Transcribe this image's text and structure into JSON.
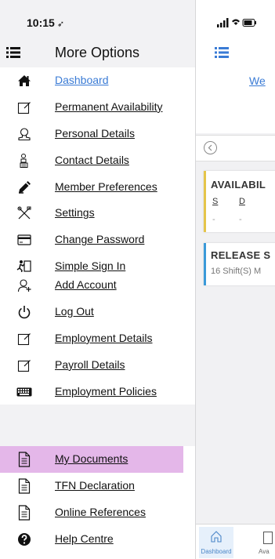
{
  "status": {
    "time": "10:15",
    "location_glyph": "➶"
  },
  "drawer": {
    "title": "More Options",
    "section1": [
      {
        "label": "Dashboard",
        "icon": "home-icon",
        "active": true
      },
      {
        "label": "Permanent Availability",
        "icon": "edit-icon"
      },
      {
        "label": "Personal Details",
        "icon": "person-icon"
      },
      {
        "label": "Contact Details",
        "icon": "contact-icon"
      },
      {
        "label": "Member Preferences",
        "icon": "pencil-icon"
      },
      {
        "label": "Settings",
        "icon": "tools-icon"
      },
      {
        "label": "Change Password",
        "icon": "card-icon"
      },
      {
        "label": "Simple Sign In",
        "icon": "runner-icon"
      }
    ],
    "section2": [
      {
        "label": "Add Account",
        "icon": "add-user-icon"
      },
      {
        "label": "Log Out",
        "icon": "power-icon"
      },
      {
        "label": "Employment Details",
        "icon": "edit-icon"
      },
      {
        "label": "Payroll Details",
        "icon": "edit-icon"
      },
      {
        "label": "Employment Policies",
        "icon": "keyboard-icon"
      }
    ],
    "section3": [
      {
        "label": "My Documents",
        "icon": "document-icon",
        "highlighted": true
      },
      {
        "label": "TFN Declaration",
        "icon": "document-icon"
      },
      {
        "label": "Online References",
        "icon": "document-icon"
      },
      {
        "label": "Help Centre",
        "icon": "help-icon"
      }
    ]
  },
  "background": {
    "welcome_text": "We",
    "availability_card": {
      "title": "AVAILABIL",
      "columns": [
        "S",
        "D"
      ],
      "values": [
        "-",
        "-"
      ]
    },
    "release_card": {
      "title": "RELEASE S",
      "subtitle": "16 Shift(S) M"
    },
    "tabs": {
      "dashboard": "Dashboard",
      "availability": "Ava"
    }
  },
  "colors": {
    "accent": "#3a7bd5",
    "highlight": "#e4b7e9",
    "availability_bar": "#e5c549",
    "release_bar": "#3a9ad9"
  }
}
